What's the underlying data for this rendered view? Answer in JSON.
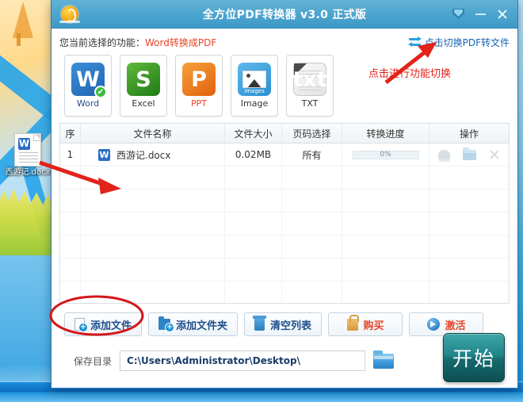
{
  "window": {
    "title": "全方位PDF转换器 v3.0 正式版",
    "logo_icon": "app-logo-icon",
    "controls": {
      "dropdown_icon": "chevron-down-badge-icon",
      "minimize_icon": "minimize-icon",
      "close_icon": "close-icon"
    }
  },
  "function_row": {
    "label": "您当前选择的功能：",
    "value": "Word转换成PDF",
    "switch_link": "点击切换PDF转文件",
    "switch_icon": "swap-arrows-icon"
  },
  "formats": [
    {
      "name": "Word",
      "glyph": "W",
      "selected": true,
      "icon": "word-format-icon",
      "check": "✔"
    },
    {
      "name": "Excel",
      "glyph": "S",
      "selected": false,
      "icon": "excel-format-icon"
    },
    {
      "name": "PPT",
      "glyph": "P",
      "selected": false,
      "icon": "ppt-format-icon"
    },
    {
      "name": "Image",
      "glyph": "",
      "selected": false,
      "icon": "image-format-icon",
      "caption": "images"
    },
    {
      "name": "TXT",
      "glyph": "txt",
      "selected": false,
      "icon": "txt-format-icon"
    }
  ],
  "table": {
    "headers": [
      "序",
      "文件名称",
      "文件大小",
      "页码选择",
      "转换进度",
      "操作"
    ],
    "rows": [
      {
        "index": "1",
        "file_icon": "W",
        "filename": "西游记.docx",
        "size": "0.02MB",
        "pages": "所有",
        "progress_text": "0%",
        "progress_value": 0,
        "actions": [
          "preview-icon",
          "open-folder-icon",
          "remove-icon"
        ]
      }
    ],
    "empty_rows": 6
  },
  "actions": [
    {
      "label": "添加文件",
      "icon": "add-file-icon",
      "red": false
    },
    {
      "label": "添加文件夹",
      "icon": "add-folder-icon",
      "red": false
    },
    {
      "label": "清空列表",
      "icon": "clear-list-icon",
      "red": false
    },
    {
      "label": "购买",
      "icon": "purchase-bag-icon",
      "red": true
    },
    {
      "label": "激活",
      "icon": "activate-icon",
      "red": true
    }
  ],
  "save": {
    "label": "保存目录",
    "path": "C:\\Users\\Administrator\\Desktop\\",
    "browse_icon": "browse-folder-icon",
    "start_label": "开始"
  },
  "annotations": {
    "switch_text": "点击进行功能切换",
    "ellipse_target": "添加文件",
    "arrow_color": "#e2231a"
  },
  "desktop": {
    "file_label": "西游记.docx",
    "file_icon": "word-document-icon"
  }
}
